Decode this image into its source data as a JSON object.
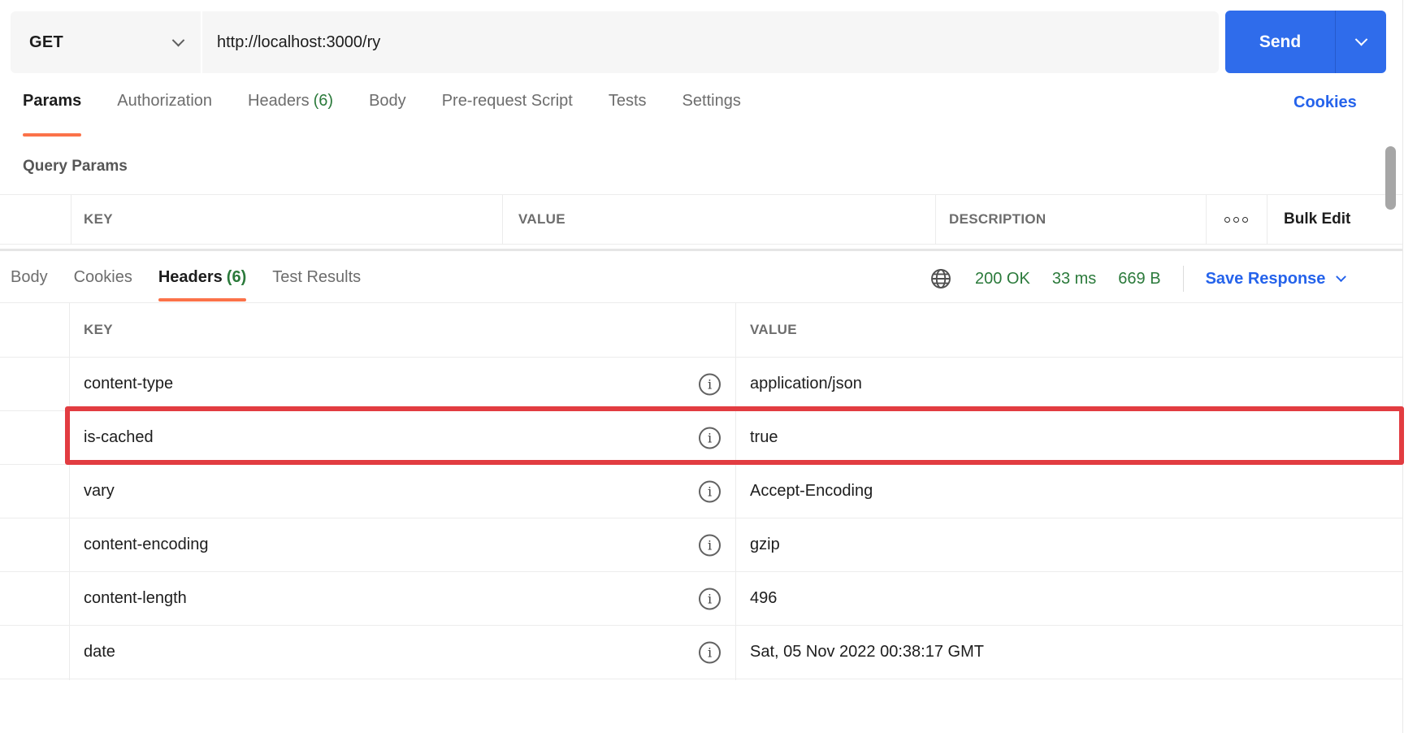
{
  "request_bar": {
    "method": "GET",
    "url": "http://localhost:3000/ry",
    "send_label": "Send"
  },
  "request_tabs": {
    "tabs": [
      {
        "label": "Params"
      },
      {
        "label": "Authorization"
      },
      {
        "label": "Headers",
        "count": "(6)"
      },
      {
        "label": "Body"
      },
      {
        "label": "Pre-request Script"
      },
      {
        "label": "Tests"
      },
      {
        "label": "Settings"
      }
    ],
    "cookies_link": "Cookies"
  },
  "query_params": {
    "title": "Query Params",
    "key_label": "KEY",
    "value_label": "VALUE",
    "description_label": "DESCRIPTION",
    "bulk_edit_label": "Bulk Edit"
  },
  "response": {
    "tabs": [
      {
        "label": "Body"
      },
      {
        "label": "Cookies"
      },
      {
        "label": "Headers",
        "count": "(6)"
      },
      {
        "label": "Test Results"
      }
    ],
    "status": {
      "code": "200 OK",
      "time": "33 ms",
      "size": "669 B"
    },
    "save_response_label": "Save Response",
    "table": {
      "key_label": "KEY",
      "value_label": "VALUE",
      "rows": [
        {
          "key": "content-type",
          "value": "application/json"
        },
        {
          "key": "is-cached",
          "value": "true",
          "highlighted": true
        },
        {
          "key": "vary",
          "value": "Accept-Encoding"
        },
        {
          "key": "content-encoding",
          "value": "gzip"
        },
        {
          "key": "content-length",
          "value": "496"
        },
        {
          "key": "date",
          "value": "Sat, 05 Nov 2022 00:38:17 GMT"
        }
      ]
    }
  },
  "colors": {
    "accent_blue": "#2f6ceb",
    "link_blue": "#2563eb",
    "success_green": "#2b7a3b",
    "tab_orange": "#fb7249",
    "highlight_red": "#e23c41"
  }
}
